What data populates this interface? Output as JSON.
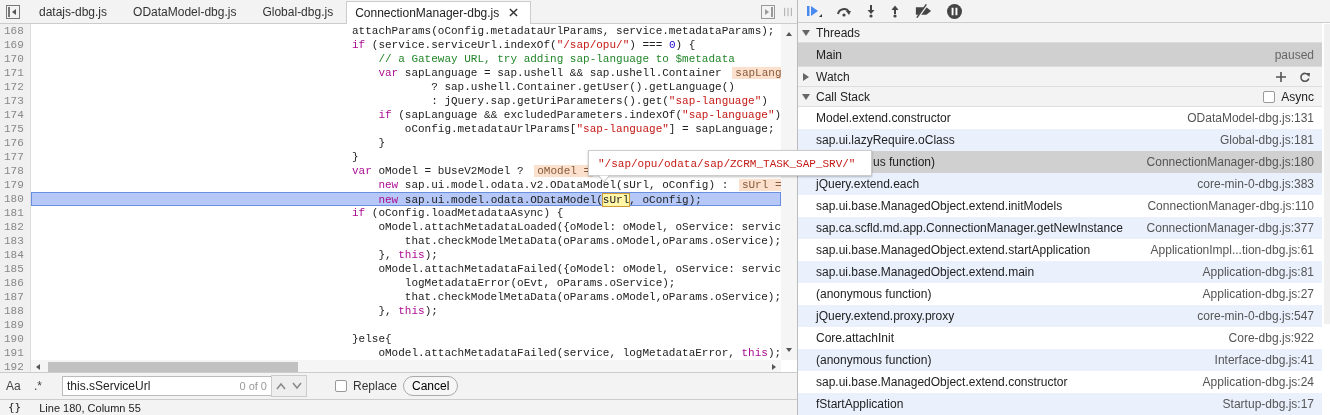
{
  "tabs": [
    {
      "label": "datajs-dbg.js",
      "selected": false
    },
    {
      "label": "ODataModel-dbg.js",
      "selected": false
    },
    {
      "label": "Global-dbg.js",
      "selected": false
    },
    {
      "label": "ConnectionManager-dbg.js",
      "selected": true
    }
  ],
  "code": {
    "lines": [
      {
        "number": "168",
        "selected": false,
        "segments": [
          {
            "kind": "plain",
            "text": "attachParams(oConfig.metadataUrlParams, service.metadataParams);"
          }
        ]
      },
      {
        "number": "169",
        "selected": false,
        "segments": [
          {
            "kind": "keyword",
            "text": "if"
          },
          {
            "kind": "plain",
            "text": " (service.serviceUrl.indexOf("
          },
          {
            "kind": "string",
            "text": "\"/sap/opu/\""
          },
          {
            "kind": "plain",
            "text": ") === "
          },
          {
            "kind": "number",
            "text": "0"
          },
          {
            "kind": "plain",
            "text": ") {"
          }
        ]
      },
      {
        "number": "170",
        "selected": false,
        "segments": [
          {
            "kind": "comment",
            "text": "    // a Gateway URL, try adding sap-language to $metadata"
          }
        ]
      },
      {
        "number": "171",
        "selected": false,
        "segments": [
          {
            "kind": "keyword",
            "text": "    var"
          },
          {
            "kind": "plain",
            "text": " sapLanguage = sap.ushell && sap.ushell.Container "
          },
          {
            "kind": "badge",
            "text": "sapLang"
          }
        ]
      },
      {
        "number": "172",
        "selected": false,
        "segments": [
          {
            "kind": "plain",
            "text": "            ? sap.ushell.Container.getUser().getLanguage()"
          }
        ]
      },
      {
        "number": "173",
        "selected": false,
        "segments": [
          {
            "kind": "plain",
            "text": "            : jQuery.sap.getUriParameters().get("
          },
          {
            "kind": "string",
            "text": "\"sap-language\""
          },
          {
            "kind": "plain",
            "text": ")"
          }
        ]
      },
      {
        "number": "174",
        "selected": false,
        "segments": [
          {
            "kind": "keyword",
            "text": "    if"
          },
          {
            "kind": "plain",
            "text": " (sapLanguage && excludedParameters.indexOf("
          },
          {
            "kind": "string",
            "text": "\"sap-language\""
          },
          {
            "kind": "plain",
            "text": ")"
          }
        ]
      },
      {
        "number": "175",
        "selected": false,
        "segments": [
          {
            "kind": "plain",
            "text": "        oConfig.metadataUrlParams["
          },
          {
            "kind": "string",
            "text": "\"sap-language\""
          },
          {
            "kind": "plain",
            "text": "] = sapLanguage;"
          }
        ]
      },
      {
        "number": "176",
        "selected": false,
        "segments": [
          {
            "kind": "plain",
            "text": "    }"
          }
        ]
      },
      {
        "number": "177",
        "selected": false,
        "segments": [
          {
            "kind": "plain",
            "text": "}"
          }
        ]
      },
      {
        "number": "178",
        "selected": false,
        "segments": [
          {
            "kind": "keyword",
            "text": "var"
          },
          {
            "kind": "plain",
            "text": " oModel = bUseV2Model ? "
          },
          {
            "kind": "badge",
            "text": "oModel ="
          }
        ]
      },
      {
        "number": "179",
        "selected": false,
        "segments": [
          {
            "kind": "keyword",
            "text": "    new"
          },
          {
            "kind": "plain",
            "text": " sap.ui.model.odata.v2.ODataModel(sUrl, oConfig) : "
          },
          {
            "kind": "badge",
            "text": "sUrl ="
          }
        ]
      },
      {
        "number": "180",
        "selected": true,
        "segments": [
          {
            "kind": "keyword",
            "text": "    new"
          },
          {
            "kind": "plain",
            "text": " sap.ui.model.odata.ODataModel("
          },
          {
            "kind": "match",
            "text": "sUrl"
          },
          {
            "kind": "plain",
            "text": ", oConfig);"
          }
        ]
      },
      {
        "number": "181",
        "selected": false,
        "segments": [
          {
            "kind": "keyword",
            "text": "if"
          },
          {
            "kind": "plain",
            "text": " (oConfig.loadMetadataAsync) {"
          }
        ]
      },
      {
        "number": "182",
        "selected": false,
        "segments": [
          {
            "kind": "plain",
            "text": "    oModel.attachMetadataLoaded({oModel: oModel, oService: servic"
          }
        ]
      },
      {
        "number": "183",
        "selected": false,
        "segments": [
          {
            "kind": "plain",
            "text": "        that.checkModelMetaData(oParams.oModel,oParams.oService);"
          }
        ]
      },
      {
        "number": "184",
        "selected": false,
        "segments": [
          {
            "kind": "plain",
            "text": "    }, "
          },
          {
            "kind": "keyword",
            "text": "this"
          },
          {
            "kind": "plain",
            "text": ");"
          }
        ]
      },
      {
        "number": "185",
        "selected": false,
        "segments": [
          {
            "kind": "plain",
            "text": "    oModel.attachMetadataFailed({oModel: oModel, oService: servic"
          }
        ]
      },
      {
        "number": "186",
        "selected": false,
        "segments": [
          {
            "kind": "plain",
            "text": "        logMetadataError(oEvt, oParams.oService);"
          }
        ]
      },
      {
        "number": "187",
        "selected": false,
        "segments": [
          {
            "kind": "plain",
            "text": "        that.checkModelMetaData(oParams.oModel,oParams.oService);"
          }
        ]
      },
      {
        "number": "188",
        "selected": false,
        "segments": [
          {
            "kind": "plain",
            "text": "    }, "
          },
          {
            "kind": "keyword",
            "text": "this"
          },
          {
            "kind": "plain",
            "text": ");"
          }
        ]
      },
      {
        "number": "189",
        "selected": false
      },
      {
        "number": "190",
        "selected": false,
        "segments": [
          {
            "kind": "plain",
            "text": "}else{"
          }
        ]
      },
      {
        "number": "191",
        "selected": false,
        "segments": [
          {
            "kind": "plain",
            "text": "    oModel.attachMetadataFailed(service, logMetadataError, "
          },
          {
            "kind": "keyword",
            "text": "this"
          },
          {
            "kind": "plain",
            "text": ");"
          }
        ]
      }
    ],
    "last_line_number": "192",
    "tooltip": "\"/sap/opu/odata/sap/ZCRM_TASK_SAP_SRV/\""
  },
  "search": {
    "case_label": "Aa",
    "regex_label": ".*",
    "value": "this.sServiceUrl",
    "count": "0 of 0",
    "replace": {
      "label": "Replace",
      "checked": false
    },
    "cancel": "Cancel"
  },
  "status": {
    "format_label": "{}",
    "position": "Line 180, Column 55"
  },
  "threads": {
    "label": "Threads",
    "expanded": true,
    "items": [
      {
        "name": "Main",
        "status": "paused",
        "selected": true
      }
    ]
  },
  "watch": {
    "label": "Watch",
    "expanded": false
  },
  "call_stack": {
    "label": "Call Stack",
    "expanded": true,
    "async": {
      "label": "Async",
      "checked": false
    },
    "frames": [
      {
        "name": "Model.extend.constructor",
        "location": "ODataModel-dbg.js:131",
        "selected": false
      },
      {
        "name": "sap.ui.lazyRequire.oClass",
        "location": "Global-dbg.js:181",
        "selected": false
      },
      {
        "name": "us function)",
        "location": "ConnectionManager-dbg.js:180",
        "selected": true
      },
      {
        "name": "jQuery.extend.each",
        "location": "core-min-0-dbg.js:383",
        "selected": false
      },
      {
        "name": "sap.ui.base.ManagedObject.extend.initModels",
        "location": "ConnectionManager-dbg.js:110",
        "selected": false
      },
      {
        "name": "sap.ca.scfld.md.app.ConnectionManager.getNewInstance",
        "location": "ConnectionManager-dbg.js:377",
        "selected": false
      },
      {
        "name": "sap.ui.base.ManagedObject.extend.startApplication",
        "location": "ApplicationImpl...tion-dbg.js:61",
        "selected": false
      },
      {
        "name": "sap.ui.base.ManagedObject.extend.main",
        "location": "Application-dbg.js:81",
        "selected": false
      },
      {
        "name": "(anonymous function)",
        "location": "Application-dbg.js:27",
        "selected": false
      },
      {
        "name": "jQuery.extend.proxy.proxy",
        "location": "core-min-0-dbg.js:547",
        "selected": false
      },
      {
        "name": "Core.attachInit",
        "location": "Core-dbg.js:922",
        "selected": false
      },
      {
        "name": "(anonymous function)",
        "location": "Interface-dbg.js:41",
        "selected": false
      },
      {
        "name": "sap.ui.base.ManagedObject.extend.constructor",
        "location": "Application-dbg.js:24",
        "selected": false
      },
      {
        "name": "fStartApplication",
        "location": "Startup-dbg.js:17",
        "selected": false
      }
    ]
  }
}
